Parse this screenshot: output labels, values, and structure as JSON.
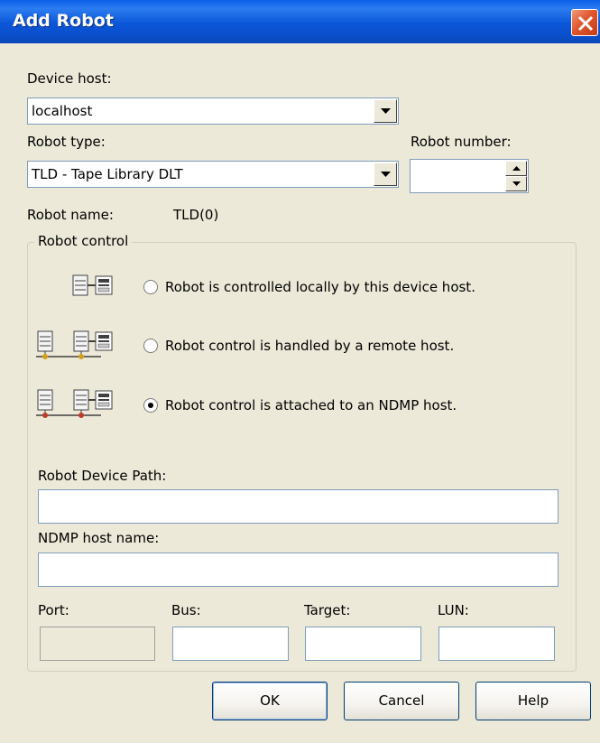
{
  "window": {
    "title": "Add Robot"
  },
  "device_host": {
    "label": "Device host:",
    "value": "localhost"
  },
  "robot_type": {
    "label": "Robot type:",
    "value": "TLD - Tape Library DLT"
  },
  "robot_number": {
    "label": "Robot number:",
    "value": ""
  },
  "robot_name": {
    "label": "Robot name:",
    "value": "TLD(0)"
  },
  "robot_control": {
    "legend": "Robot control",
    "options": [
      {
        "label": "Robot is controlled locally by this device host.",
        "selected": false
      },
      {
        "label": "Robot control is handled by a remote host.",
        "selected": false
      },
      {
        "label": "Robot control is attached to an NDMP host.",
        "selected": true
      }
    ]
  },
  "robot_device_path": {
    "label": "Robot Device Path:",
    "value": ""
  },
  "ndmp_host_name": {
    "label": "NDMP host name:",
    "value": ""
  },
  "port": {
    "label": "Port:",
    "value": ""
  },
  "bus": {
    "label": "Bus:",
    "value": ""
  },
  "target": {
    "label": "Target:",
    "value": ""
  },
  "lun": {
    "label": "LUN:",
    "value": ""
  },
  "buttons": {
    "ok": "OK",
    "cancel": "Cancel",
    "help": "Help"
  },
  "colors": {
    "titlebar": "#0a56d8",
    "close": "#e0572e",
    "dialog_bg": "#ece9d8"
  }
}
